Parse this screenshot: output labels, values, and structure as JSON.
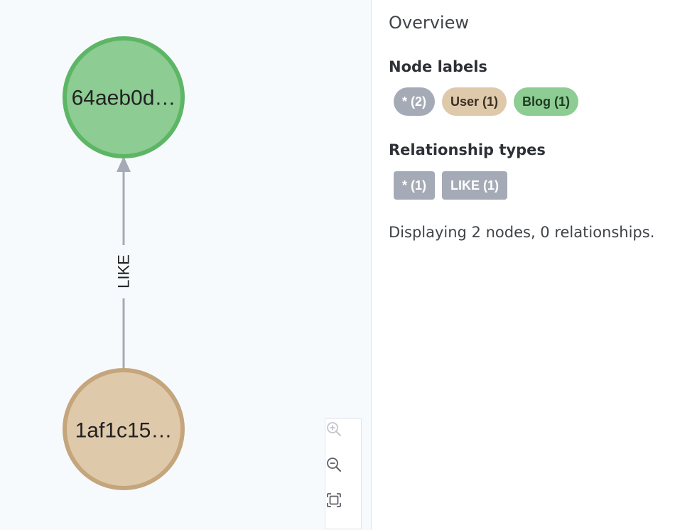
{
  "graph": {
    "nodes": [
      {
        "caption": "64aeb0d…",
        "label": "Blog",
        "fill": "#8dcc93",
        "stroke": "#5db665"
      },
      {
        "caption": "1af1c15…",
        "label": "User",
        "fill": "#dfc9ab",
        "stroke": "#c4a57c"
      }
    ],
    "relationship": {
      "type": "LIKE",
      "color": "#a5abb6"
    }
  },
  "zoom_controls": {
    "zoom_in": "zoom-in-icon",
    "zoom_out": "zoom-out-icon",
    "fit": "fit-to-screen-icon"
  },
  "overview": {
    "title": "Overview",
    "node_labels_heading": "Node labels",
    "node_labels": [
      {
        "text": "* (2)",
        "bg": "#a5abb6",
        "color": "#ffffff"
      },
      {
        "text": "User (1)",
        "bg": "#dfc9ab",
        "color": "#3a2f22"
      },
      {
        "text": "Blog (1)",
        "bg": "#8dcc93",
        "color": "#1f3a22"
      }
    ],
    "relationship_types_heading": "Relationship types",
    "relationship_types": [
      {
        "text": "* (1)",
        "bg": "#a5abb6",
        "color": "#ffffff"
      },
      {
        "text": "LIKE (1)",
        "bg": "#a5abb6",
        "color": "#ffffff"
      }
    ],
    "status": "Displaying 2 nodes, 0 relationships."
  }
}
